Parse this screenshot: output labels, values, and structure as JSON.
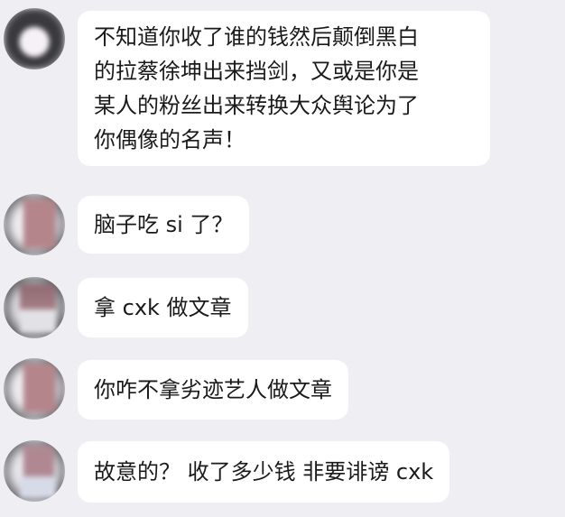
{
  "messages": [
    {
      "lines": [
        "不知道你收了谁的钱然后颠倒黑白",
        "的拉蔡徐坤出来挡剑，又或是你是",
        "某人的粉丝出来转换大众舆论为了",
        "你偶像的名声！"
      ]
    },
    {
      "text": "脑子吃 si 了？"
    },
    {
      "text": "拿 cxk 做文章"
    },
    {
      "text": "你咋不拿劣迹艺人做文章"
    },
    {
      "text": "故意的？ 收了多少钱 非要诽谤 cxk"
    }
  ]
}
